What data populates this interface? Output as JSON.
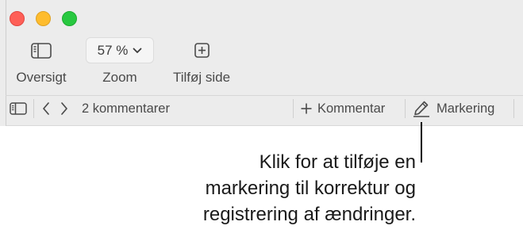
{
  "toolbar": {
    "sidebar_label": "Oversigt",
    "zoom_value": "57 %",
    "zoom_label": "Zoom",
    "add_page_label": "Tilføj side"
  },
  "comments_bar": {
    "count_text": "2 kommentarer",
    "add_comment_label": "Kommentar",
    "markup_label": "Markering"
  },
  "callout": {
    "lines": [
      "Klik for at tilføje en",
      "markering til korrektur og",
      "registrering af ændringer."
    ]
  },
  "colors": {
    "close": "#fe5f57",
    "minimize": "#febc2e",
    "maximize": "#28c840",
    "toolbar_bg": "#ececec"
  },
  "icons": [
    "sidebar-icon",
    "chevron-down-icon",
    "add-page-icon",
    "chevron-left-icon",
    "chevron-right-icon",
    "plus-icon",
    "pen-icon"
  ]
}
